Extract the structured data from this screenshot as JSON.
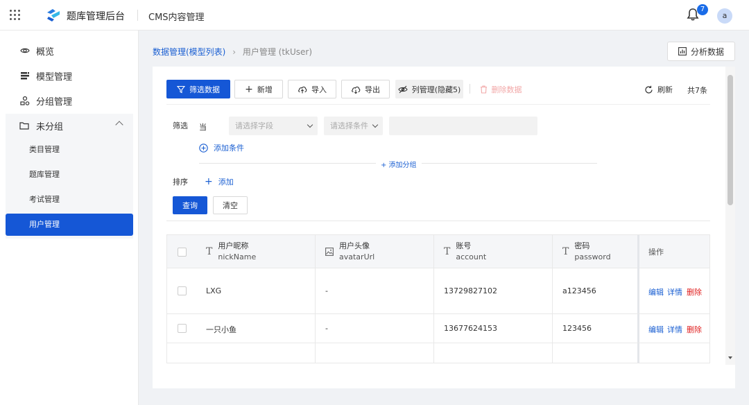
{
  "header": {
    "app_title": "题库管理后台",
    "cms_title": "CMS内容管理",
    "notification_count": "7",
    "avatar_letter": "a"
  },
  "sidebar": {
    "items": [
      {
        "label": "概览",
        "icon": "eye-icon"
      },
      {
        "label": "模型管理",
        "icon": "model-icon"
      },
      {
        "label": "分组管理",
        "icon": "group-icon"
      }
    ],
    "group": {
      "label": "未分组",
      "icon": "folder-icon",
      "expanded": true,
      "items": [
        "类目管理",
        "题库管理",
        "考试管理",
        "用户管理"
      ],
      "active_item": "用户管理"
    }
  },
  "breadcrumb": {
    "parent": "数据管理(模型列表)",
    "separator": "›",
    "current": "用户管理 (tkUser)"
  },
  "analyze_button": "分析数据",
  "toolbar": {
    "filter": "筛选数据",
    "add": "新增",
    "import": "导入",
    "export": "导出",
    "columns": "列管理(隐藏5)",
    "delete": "删除数据",
    "refresh": "刷新",
    "total": "共7条"
  },
  "filter": {
    "label": "筛选",
    "when": "当",
    "field_placeholder": "请选择字段",
    "condition_placeholder": "请选择条件",
    "add_condition": "添加条件",
    "add_group": "+ 添加分组"
  },
  "sort": {
    "label": "排序",
    "add": "添加"
  },
  "buttons": {
    "query": "查询",
    "clear": "清空"
  },
  "table": {
    "columns": [
      {
        "title": "用户昵称",
        "field": "nickName",
        "icon": "text-type-icon"
      },
      {
        "title": "用户头像",
        "field": "avatarUrl",
        "icon": "image-type-icon"
      },
      {
        "title": "账号",
        "field": "account",
        "icon": "text-type-icon"
      },
      {
        "title": "密码",
        "field": "password",
        "icon": "text-type-icon"
      }
    ],
    "action_header": "操作",
    "rows": [
      {
        "nickName": "LXG",
        "avatarUrl": "-",
        "account": "13729827102",
        "password": "a123456"
      },
      {
        "nickName": "一只小鱼",
        "avatarUrl": "-",
        "account": "13677624153",
        "password": "123456"
      }
    ],
    "actions": {
      "edit": "编辑",
      "detail": "详情",
      "delete": "删除"
    }
  },
  "colors": {
    "primary": "#1557d6",
    "link": "#1a5fd2",
    "danger": "#e02020"
  }
}
